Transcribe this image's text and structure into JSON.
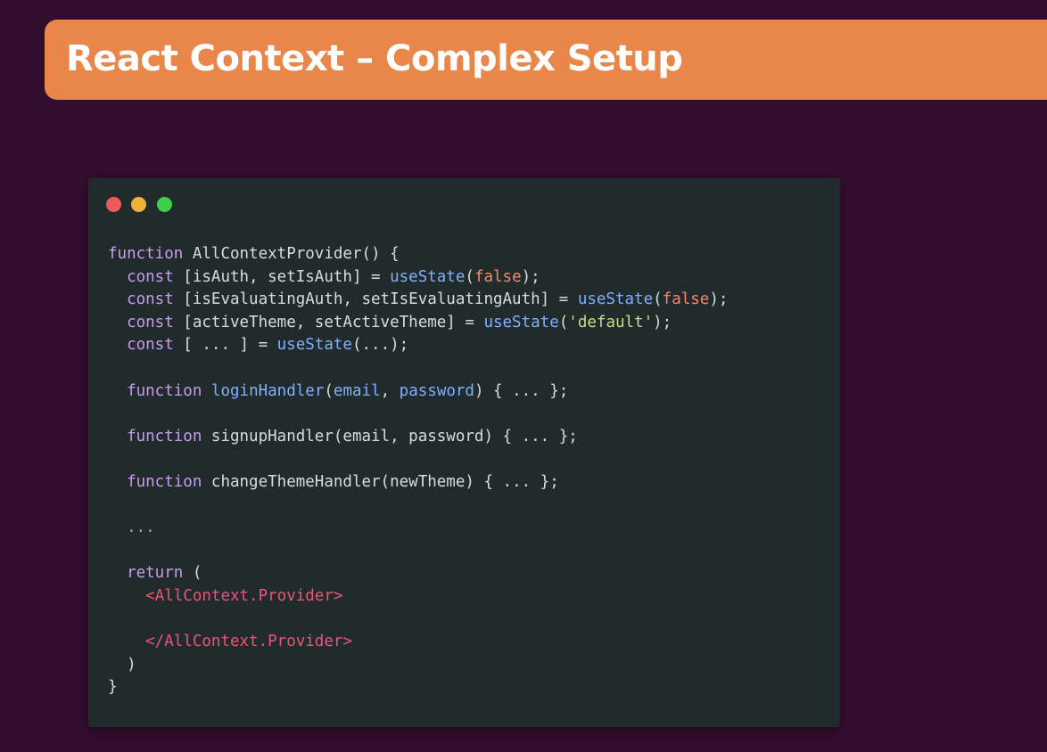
{
  "slide": {
    "title": "React Context – Complex Setup"
  },
  "window_controls": {
    "close_color": "#ed5a5a",
    "minimize_color": "#f0b13a",
    "maximize_color": "#3fcf4c"
  },
  "code": {
    "kw_function": "function",
    "kw_const": "const",
    "kw_return": "return",
    "line1_name": " AllContextProvider() {",
    "line2_destructure": " [isAuth, setIsAuth] = ",
    "useState": "useState",
    "open_paren": "(",
    "false": "false",
    "close_paren_semi": ");",
    "line3_destructure": " [isEvaluatingAuth, setIsEvaluatingAuth] = ",
    "line4_destructure": " [activeTheme, setActiveTheme] = ",
    "default_str": "'default'",
    "line5_destructure": " [ ... ] = ",
    "line5_args": "(...);",
    "loginHandler": "loginHandler",
    "login_params_open": "(",
    "email": "email",
    "comma": ", ",
    "password": "password",
    "login_rest": ") { ... };",
    "signup_rest": " signupHandler(email, password) { ... };",
    "theme_rest": " changeThemeHandler(newTheme) { ... };",
    "ellipsis": "...",
    "return_rest": " (",
    "jsx_open": "<AllContext.Provider>",
    "jsx_close": "</AllContext.Provider>",
    "close_paren": ")",
    "close_brace": "}"
  }
}
